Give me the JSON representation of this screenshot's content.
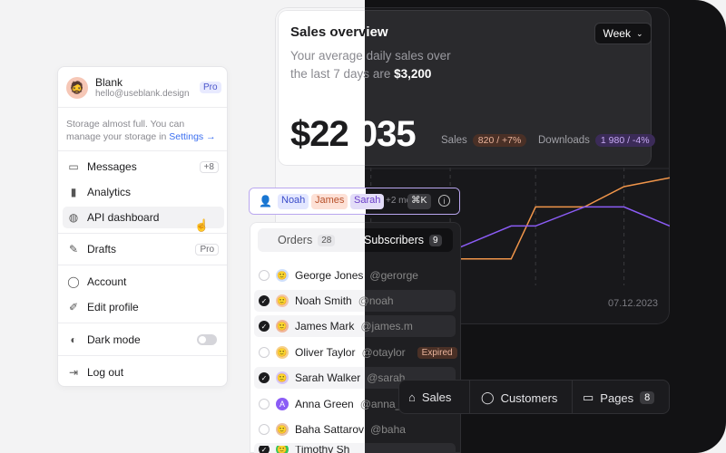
{
  "sales": {
    "title_light": "Sales overv",
    "title_dark": "iew",
    "subtitle_prefix_light": "Your average",
    "subtitle_prefix_dark": " daily sales over",
    "subtitle_line2_light": "the last 7 days",
    "subtitle_line2_dark": " are ",
    "subtitle_amount": "$3,200",
    "total_light": "$22",
    "total_dark": "035",
    "period": "Week",
    "kpi_sales_label": "Sales",
    "kpi_sales_value": "820 / +7%",
    "kpi_downloads_label": "Downloads",
    "kpi_downloads_value": "1 980 / -4%",
    "chart_date": "07.12.2023"
  },
  "chart_data": {
    "type": "line",
    "series": [
      {
        "name": "Sales",
        "color": "#f0954a",
        "values": [
          0.46,
          0.28,
          0.28,
          0.69,
          0.69,
          0.85,
          0.92
        ]
      },
      {
        "name": "Downloads",
        "color": "#8b5cf6",
        "values": [
          0.31,
          0.31,
          0.54,
          0.54,
          0.69,
          0.69,
          0.54
        ]
      }
    ]
  },
  "menu": {
    "user_name": "Blank",
    "user_email": "hello@useblank.design",
    "plan_badge": "Pro",
    "storage_text": "Storage almost full. You can manage your storage in ",
    "storage_link": "Settings →",
    "items": [
      {
        "label": "Messages",
        "tag": "+8"
      },
      {
        "label": "Analytics"
      },
      {
        "label": "API dashboard"
      },
      {
        "label": "Drafts",
        "tag": "Pro"
      },
      {
        "label": "Account"
      },
      {
        "label": "Edit profile"
      },
      {
        "label": "Dark mode"
      },
      {
        "label": "Log out"
      }
    ]
  },
  "userbar": {
    "chips": [
      "Noah",
      "James",
      "Sarah"
    ],
    "more": "+2 mo",
    "shortcut": "⌘K"
  },
  "user_panel": {
    "tab_orders": "Orders",
    "tab_orders_count": "28",
    "tab_subscribers": "Subscribers",
    "tab_subscribers_count": "9",
    "users": [
      {
        "name": "George Jones",
        "handle": "@gerorge",
        "checked": false
      },
      {
        "name": "Noah Smith",
        "handle": "@noah",
        "checked": true
      },
      {
        "name": "James Mark",
        "handle": "@james.m",
        "checked": true
      },
      {
        "name": "Oliver Taylor",
        "handle": "@otaylor",
        "checked": false,
        "status": "Expired"
      },
      {
        "name": "Sarah Walker",
        "handle": "@sarah",
        "checked": true
      },
      {
        "name": "Anna Green",
        "handle": "@anna_gre",
        "checked": false,
        "initial": "A"
      },
      {
        "name": "Baha Sattarov",
        "handle": "@baha",
        "checked": false
      },
      {
        "name": "Timothy Sh",
        "handle": "",
        "checked": true
      }
    ]
  },
  "bottom_nav": {
    "sales": "Sales",
    "customers": "Customers",
    "pages": "Pages",
    "pages_count": "8"
  }
}
